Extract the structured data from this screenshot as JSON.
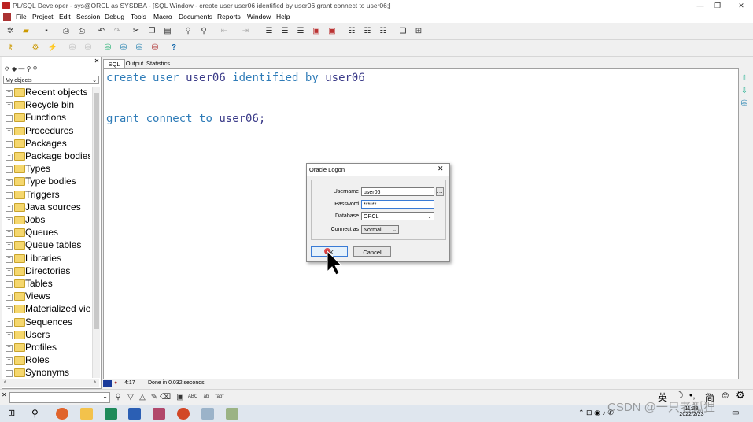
{
  "window": {
    "title": "PL/SQL Developer - sys@ORCL as SYSDBA - [SQL Window - create user user06 identified by user06 grant connect to user06;]"
  },
  "menu": [
    "File",
    "Project",
    "Edit",
    "Session",
    "Debug",
    "Tools",
    "Macro",
    "Documents",
    "Reports",
    "Window",
    "Help"
  ],
  "tabs": [
    "SQL",
    "Output",
    "Statistics"
  ],
  "object_browser": {
    "filter": "My objects",
    "items": [
      "Recent objects",
      "Recycle bin",
      "Functions",
      "Procedures",
      "Packages",
      "Package bodies",
      "Types",
      "Type bodies",
      "Triggers",
      "Java sources",
      "Jobs",
      "Queues",
      "Queue tables",
      "Libraries",
      "Directories",
      "Tables",
      "Views",
      "Materialized views",
      "Sequences",
      "Users",
      "Profiles",
      "Roles",
      "Synonyms"
    ]
  },
  "editor": {
    "line1": {
      "k1": "create",
      "k2": "user",
      "id1": "user06",
      "k3": "identified",
      "k4": "by",
      "id2": "user06"
    },
    "line2": {
      "k1": "grant",
      "k2": "connect",
      "k3": "to",
      "id1": "user06;"
    }
  },
  "status": {
    "position": "4:17",
    "message": "Done in 0.032 seconds"
  },
  "dialog": {
    "title": "Oracle Logon",
    "username_label": "Username",
    "username": "user06",
    "password_label": "Password",
    "password": "******",
    "database_label": "Database",
    "database": "ORCL",
    "connect_as_label": "Connect as",
    "connect_as": "Normal",
    "ok": "OK",
    "cancel": "Cancel"
  },
  "tray": {
    "time": "11:28",
    "date": "2022/2/23",
    "ime1": "英",
    "ime2": "简",
    "watermark": "CSDN @一只老狐狸"
  }
}
